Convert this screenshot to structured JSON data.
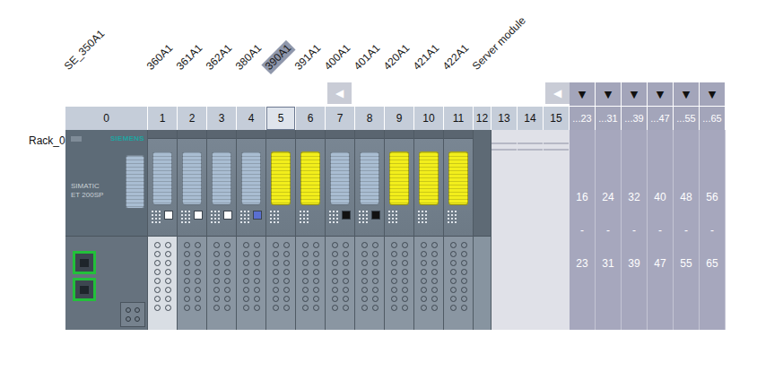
{
  "rack": {
    "label": "Rack_0"
  },
  "interface_module": {
    "brand": "SIEMENS",
    "product": "SIMATIC",
    "model": "ET 200SP"
  },
  "slots": [
    {
      "number": "0",
      "label": "SE_350A1",
      "kind": "interface",
      "selected": false,
      "color": "#a9bdd2"
    },
    {
      "number": "1",
      "label": "360A1",
      "kind": "io",
      "selected": false,
      "color": "#a9bdd2",
      "light_base": true,
      "marker": "#ffffff"
    },
    {
      "number": "2",
      "label": "361A1",
      "kind": "io",
      "selected": false,
      "color": "#a9bdd2",
      "light_base": false,
      "marker": "#ffffff"
    },
    {
      "number": "3",
      "label": "362A1",
      "kind": "io",
      "selected": false,
      "color": "#a9bdd2",
      "light_base": false,
      "marker": "#ffffff"
    },
    {
      "number": "4",
      "label": "380A1",
      "kind": "io",
      "selected": false,
      "color": "#a9bdd2",
      "light_base": false,
      "marker": "#5a6fd0"
    },
    {
      "number": "5",
      "label": "390A1",
      "kind": "io",
      "selected": true,
      "color": "#f2ee1c",
      "light_base": false
    },
    {
      "number": "6",
      "label": "391A1",
      "kind": "io",
      "selected": false,
      "color": "#f2ee1c",
      "light_base": false
    },
    {
      "number": "7",
      "label": "400A1",
      "kind": "io",
      "selected": false,
      "color": "#a9bdd2",
      "light_base": false,
      "marker": "#111111",
      "arrow": "◀"
    },
    {
      "number": "8",
      "label": "401A1",
      "kind": "io",
      "selected": false,
      "color": "#a9bdd2",
      "light_base": false,
      "marker": "#111111"
    },
    {
      "number": "9",
      "label": "420A1",
      "kind": "io",
      "selected": false,
      "color": "#f2ee1c",
      "light_base": false
    },
    {
      "number": "10",
      "label": "421A1",
      "kind": "io",
      "selected": false,
      "color": "#f2ee1c",
      "light_base": false
    },
    {
      "number": "11",
      "label": "422A1",
      "kind": "io",
      "selected": false,
      "color": "#f2ee1c",
      "light_base": false
    },
    {
      "number": "12",
      "label": "Server module",
      "kind": "server",
      "selected": false
    },
    {
      "number": "13",
      "kind": "empty",
      "selected": false
    },
    {
      "number": "14",
      "kind": "empty",
      "selected": false
    },
    {
      "number": "15",
      "kind": "empty",
      "selected": false,
      "arrow": "◀"
    }
  ],
  "groups": [
    {
      "header": "...23",
      "toggle": "▼",
      "from": "16",
      "dash": "-",
      "to": "23"
    },
    {
      "header": "...31",
      "toggle": "▼",
      "from": "24",
      "dash": "-",
      "to": "31"
    },
    {
      "header": "...39",
      "toggle": "▼",
      "from": "32",
      "dash": "-",
      "to": "39"
    },
    {
      "header": "...47",
      "toggle": "▼",
      "from": "40",
      "dash": "-",
      "to": "47"
    },
    {
      "header": "...55",
      "toggle": "▼",
      "from": "48",
      "dash": "-",
      "to": "55"
    },
    {
      "header": "...65",
      "toggle": "▼",
      "from": "56",
      "dash": "-",
      "to": "65"
    }
  ]
}
